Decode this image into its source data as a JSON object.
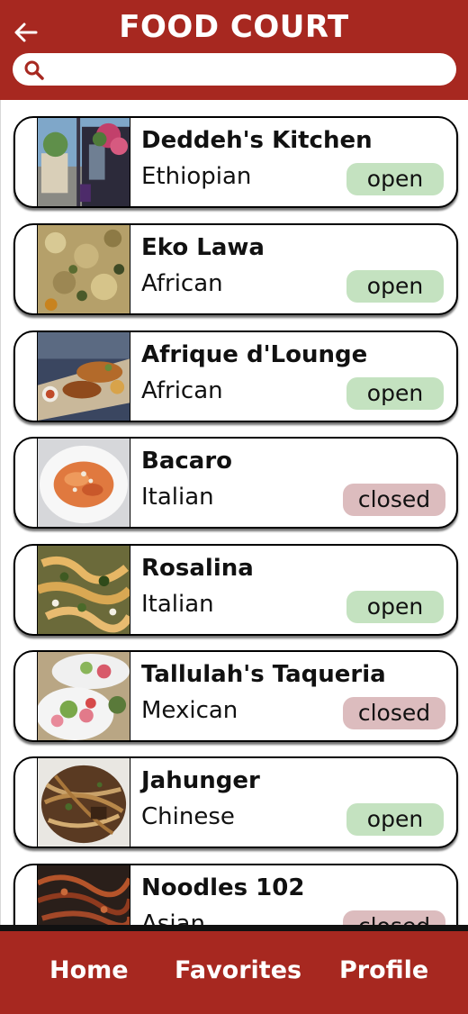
{
  "header": {
    "title": "FOOD COURT",
    "back_icon": "arrow-left-icon",
    "accent_color": "#a72820"
  },
  "search": {
    "icon": "search-icon",
    "value": "",
    "placeholder": ""
  },
  "restaurants": [
    {
      "name": "Deddeh's Kitchen",
      "cuisine": "Ethiopian",
      "status": "open"
    },
    {
      "name": "Eko Lawa",
      "cuisine": "African",
      "status": "open"
    },
    {
      "name": "Afrique d'Lounge",
      "cuisine": "African",
      "status": "open"
    },
    {
      "name": "Bacaro",
      "cuisine": "Italian",
      "status": "closed"
    },
    {
      "name": "Rosalina",
      "cuisine": "Italian",
      "status": "open"
    },
    {
      "name": "Tallulah's Taqueria",
      "cuisine": "Mexican",
      "status": "closed"
    },
    {
      "name": "Jahunger",
      "cuisine": "Chinese",
      "status": "open"
    },
    {
      "name": "Noodles 102",
      "cuisine": "Asian",
      "status": "closed"
    }
  ],
  "status_colors": {
    "open": "#c4e2c0",
    "closed": "#dcbcbe"
  },
  "nav": {
    "home": "Home",
    "favorites": "Favorites",
    "profile": "Profile"
  }
}
